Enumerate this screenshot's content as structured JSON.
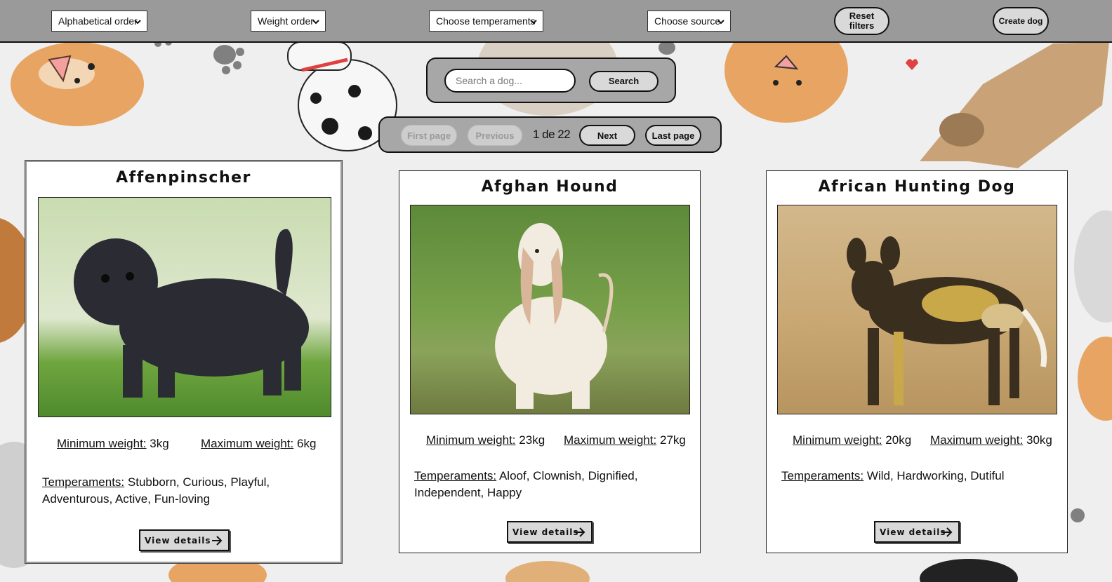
{
  "filters": {
    "alphabetical": "Alphabetical order",
    "weight": "Weight order",
    "temperaments": "Choose temperaments",
    "source": "Choose source",
    "reset_line1": "Reset",
    "reset_line2": "filters",
    "create": "Create dog"
  },
  "search": {
    "placeholder": "Search a dog...",
    "button": "Search"
  },
  "pagination": {
    "first": "First page",
    "previous": "Previous",
    "label": "1 de 22",
    "next": "Next",
    "last": "Last page"
  },
  "labels": {
    "min_weight": "Minimum weight:",
    "max_weight": "Maximum weight:",
    "temperaments": "Temperaments:",
    "view_details": "View details"
  },
  "dogs": [
    {
      "name": "Affenpinscher",
      "min_weight": "3kg",
      "max_weight": "6kg",
      "temperaments": "Stubborn, Curious, Playful, Adventurous, Active, Fun-loving"
    },
    {
      "name": "Afghan Hound",
      "min_weight": "23kg",
      "max_weight": "27kg",
      "temperaments": "Aloof, Clownish, Dignified, Independent, Happy"
    },
    {
      "name": "African Hunting Dog",
      "min_weight": "20kg",
      "max_weight": "30kg",
      "temperaments": "Wild, Hardworking, Dutiful"
    }
  ],
  "colors": {
    "topbar": "#9a9a9a",
    "panel": "#a7a7a7",
    "button": "#d9d9d9",
    "background": "#efefef"
  }
}
